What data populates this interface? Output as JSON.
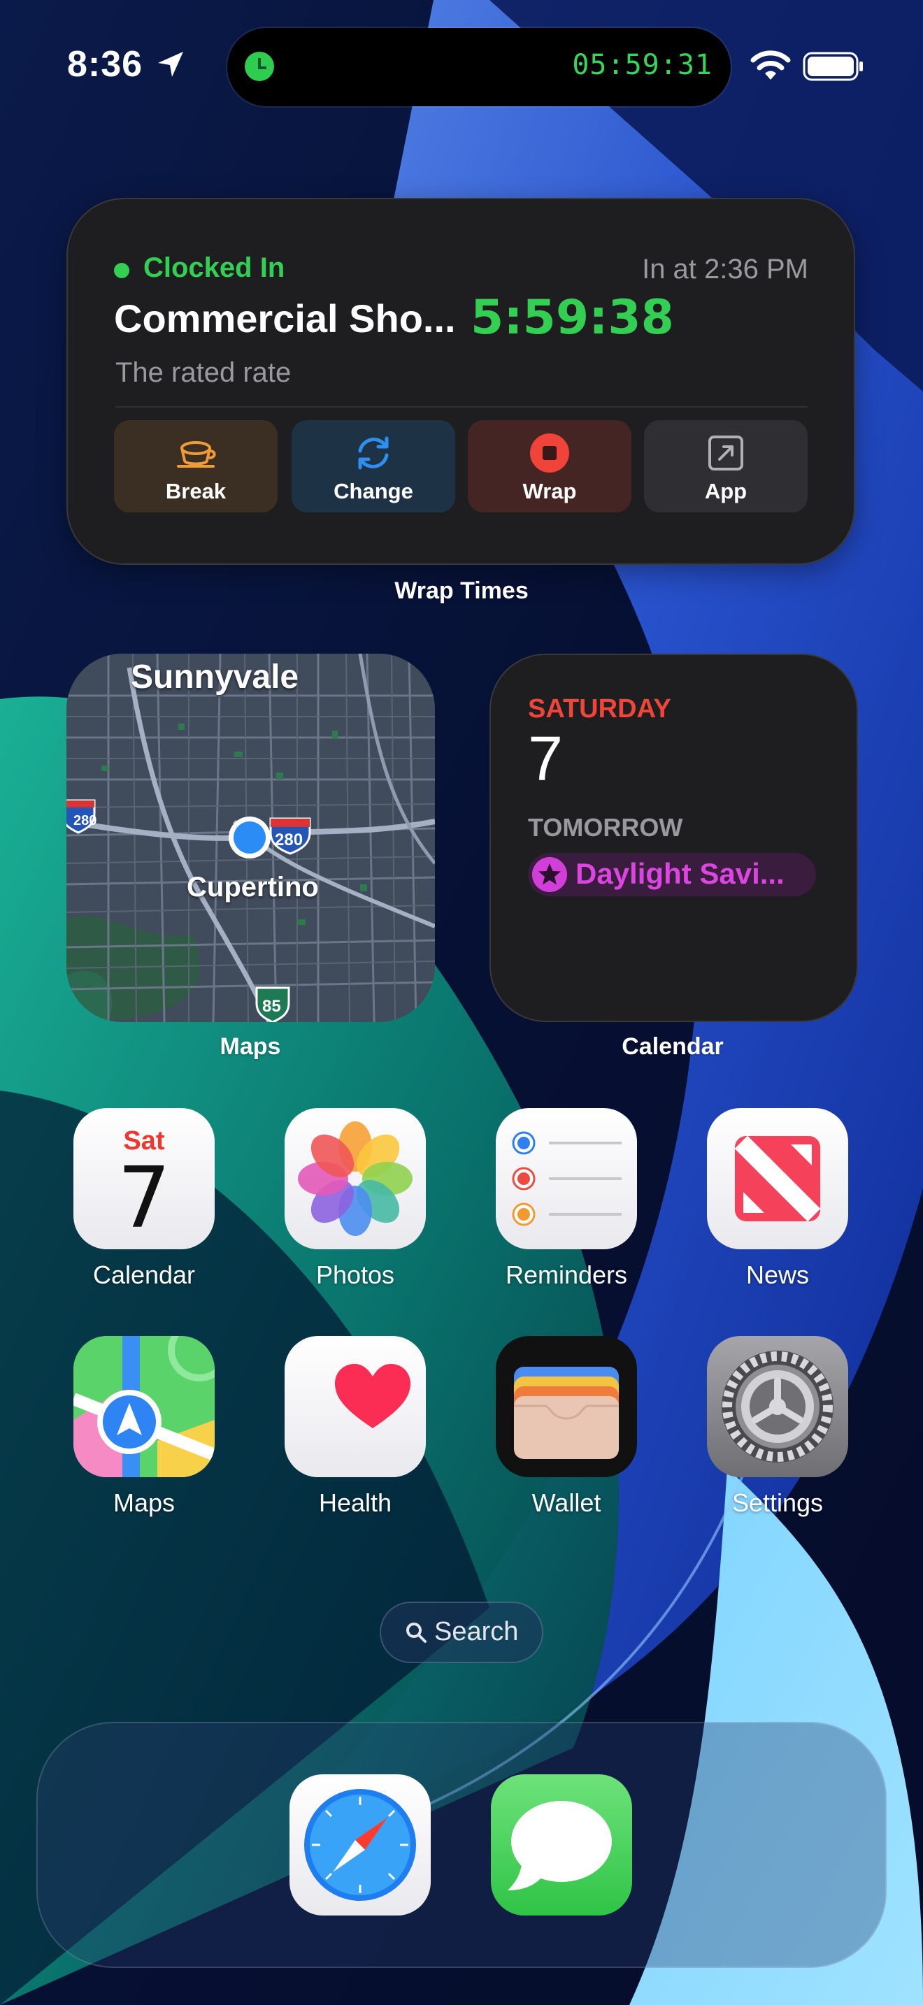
{
  "status_bar": {
    "time": "8:36",
    "location_icon": "location-arrow-icon",
    "live_activity_timer": "05:59:31",
    "wifi_icon": "wifi-icon",
    "battery_icon": "battery-full-icon"
  },
  "wrap_widget": {
    "status": "Clocked In",
    "clock_in_time": "In at 2:36 PM",
    "title": "Commercial Sho...",
    "elapsed": "5:59:38",
    "rate": "The rated rate",
    "buttons": [
      {
        "label": "Break",
        "icon": "coffee-cup-icon",
        "color": "#f09a38"
      },
      {
        "label": "Change",
        "icon": "refresh-icon",
        "color": "#2f8ff0"
      },
      {
        "label": "Wrap",
        "icon": "stop-icon",
        "color": "#f0443a"
      },
      {
        "label": "App",
        "icon": "open-external-icon",
        "color": "#b0b0b5"
      }
    ],
    "caption": "Wrap Times"
  },
  "maps_widget": {
    "city_top": "Sunnyvale",
    "city_center": "Cupertino",
    "shields": [
      "280",
      "280",
      "85"
    ],
    "caption": "Maps"
  },
  "calendar_widget": {
    "weekday": "SATURDAY",
    "date": "7",
    "tomorrow_label": "TOMORROW",
    "event": "Daylight Savi...",
    "caption": "Calendar"
  },
  "apps_row1": [
    {
      "label": "Calendar",
      "icon": "calendar-app-icon",
      "day": "Sat",
      "date": "7"
    },
    {
      "label": "Photos",
      "icon": "photos-app-icon"
    },
    {
      "label": "Reminders",
      "icon": "reminders-app-icon"
    },
    {
      "label": "News",
      "icon": "news-app-icon"
    }
  ],
  "apps_row2": [
    {
      "label": "Maps",
      "icon": "maps-app-icon"
    },
    {
      "label": "Health",
      "icon": "health-app-icon"
    },
    {
      "label": "Wallet",
      "icon": "wallet-app-icon"
    },
    {
      "label": "Settings",
      "icon": "settings-app-icon"
    }
  ],
  "search": {
    "label": "Search",
    "icon": "magnifier-icon"
  },
  "dock": [
    {
      "label": "Safari",
      "icon": "safari-app-icon"
    },
    {
      "label": "Messages",
      "icon": "messages-app-icon"
    }
  ],
  "colors": {
    "green": "#33cf52",
    "red": "#f0463a",
    "magenta": "#db46e0"
  }
}
